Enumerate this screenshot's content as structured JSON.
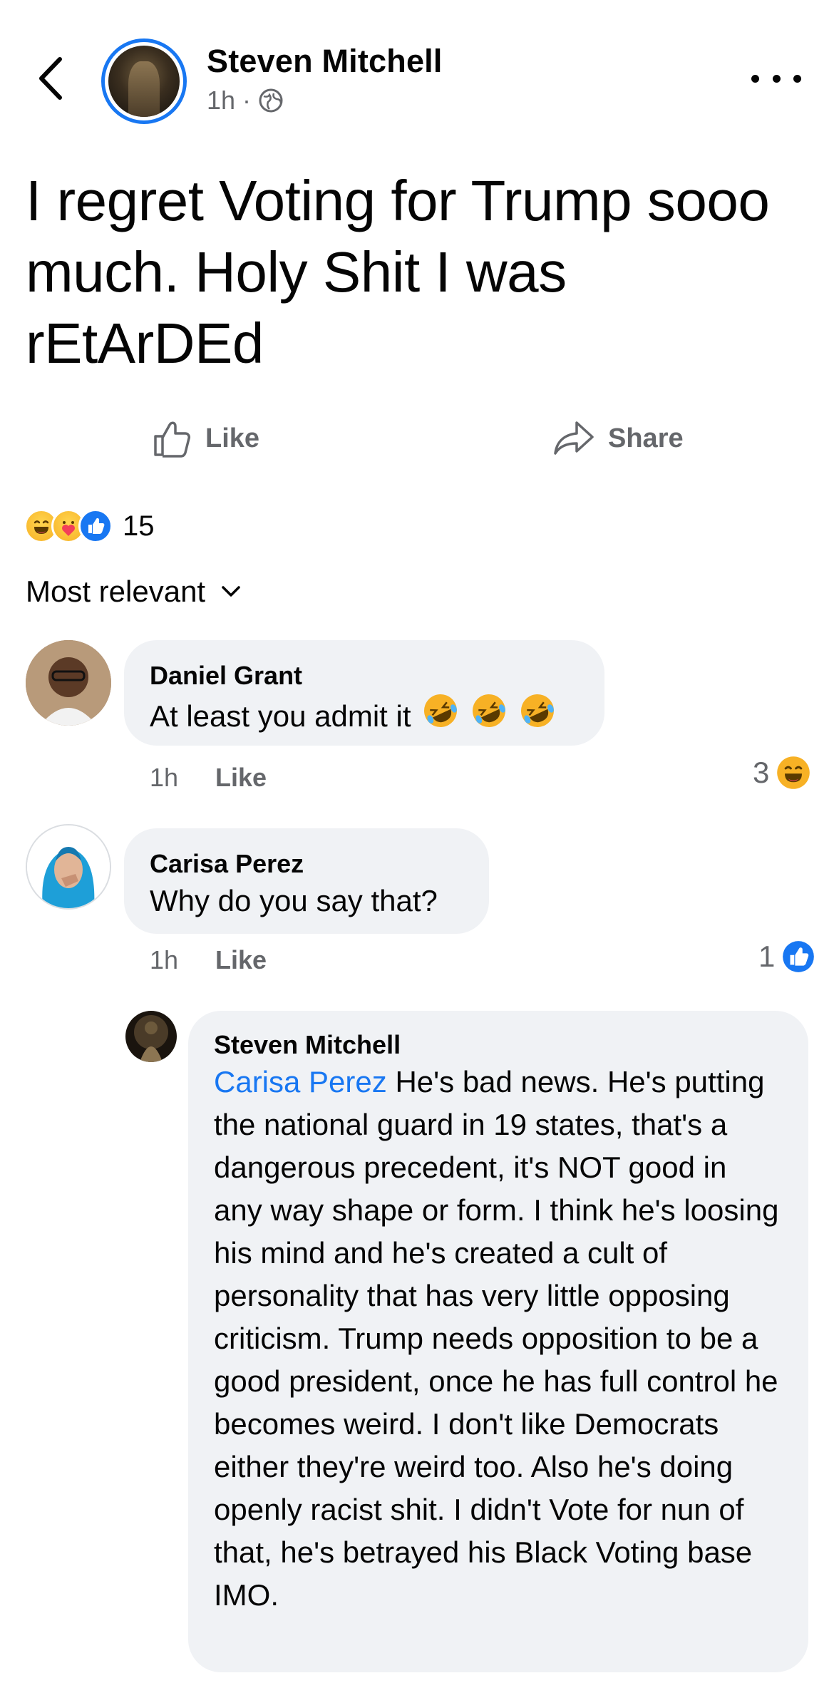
{
  "header": {
    "author": "Steven Mitchell",
    "time": "1h",
    "privacy_icon": "globe-icon",
    "back_icon": "chevron-left-icon",
    "more_icon": "more-horizontal-icon"
  },
  "post": {
    "text": "I regret Voting for Trump sooo much. Holy Shit I was rEtArDEd"
  },
  "actions": {
    "like_label": "Like",
    "share_label": "Share"
  },
  "reactions": {
    "icons": [
      "haha-icon",
      "care-icon",
      "like-reaction-icon"
    ],
    "count": "15"
  },
  "sort": {
    "label": "Most relevant"
  },
  "comments": [
    {
      "name": "Daniel Grant",
      "text": "At least you admit it",
      "emojis": [
        "rofl-emoji",
        "rofl-emoji",
        "rofl-emoji"
      ],
      "time": "1h",
      "like_label": "Like",
      "reaction_count": "3",
      "reaction_icon": "haha-icon"
    },
    {
      "name": "Carisa Perez",
      "text": "Why do you say that?",
      "time": "1h",
      "like_label": "Like",
      "reaction_count": "1",
      "reaction_icon": "like-reaction-icon"
    },
    {
      "name": "Steven Mitchell",
      "mention": "Carisa Perez",
      "text": "He's bad news. He's putting the national guard in 19 states, that's a dangerous precedent, it's NOT good in any way shape or form. I think he's loosing his mind and he's created a cult of personality that has very little opposing criticism. Trump needs opposition to be a good president, once he has full control he becomes weird. I don't like Democrats either they're weird too. Also he's doing openly racist shit. I didn't Vote for nun of that, he's betrayed his Black Voting base IMO."
    }
  ],
  "colors": {
    "accent": "#1877f2",
    "bubble": "#f0f2f5",
    "secondary_text": "#65676b"
  }
}
